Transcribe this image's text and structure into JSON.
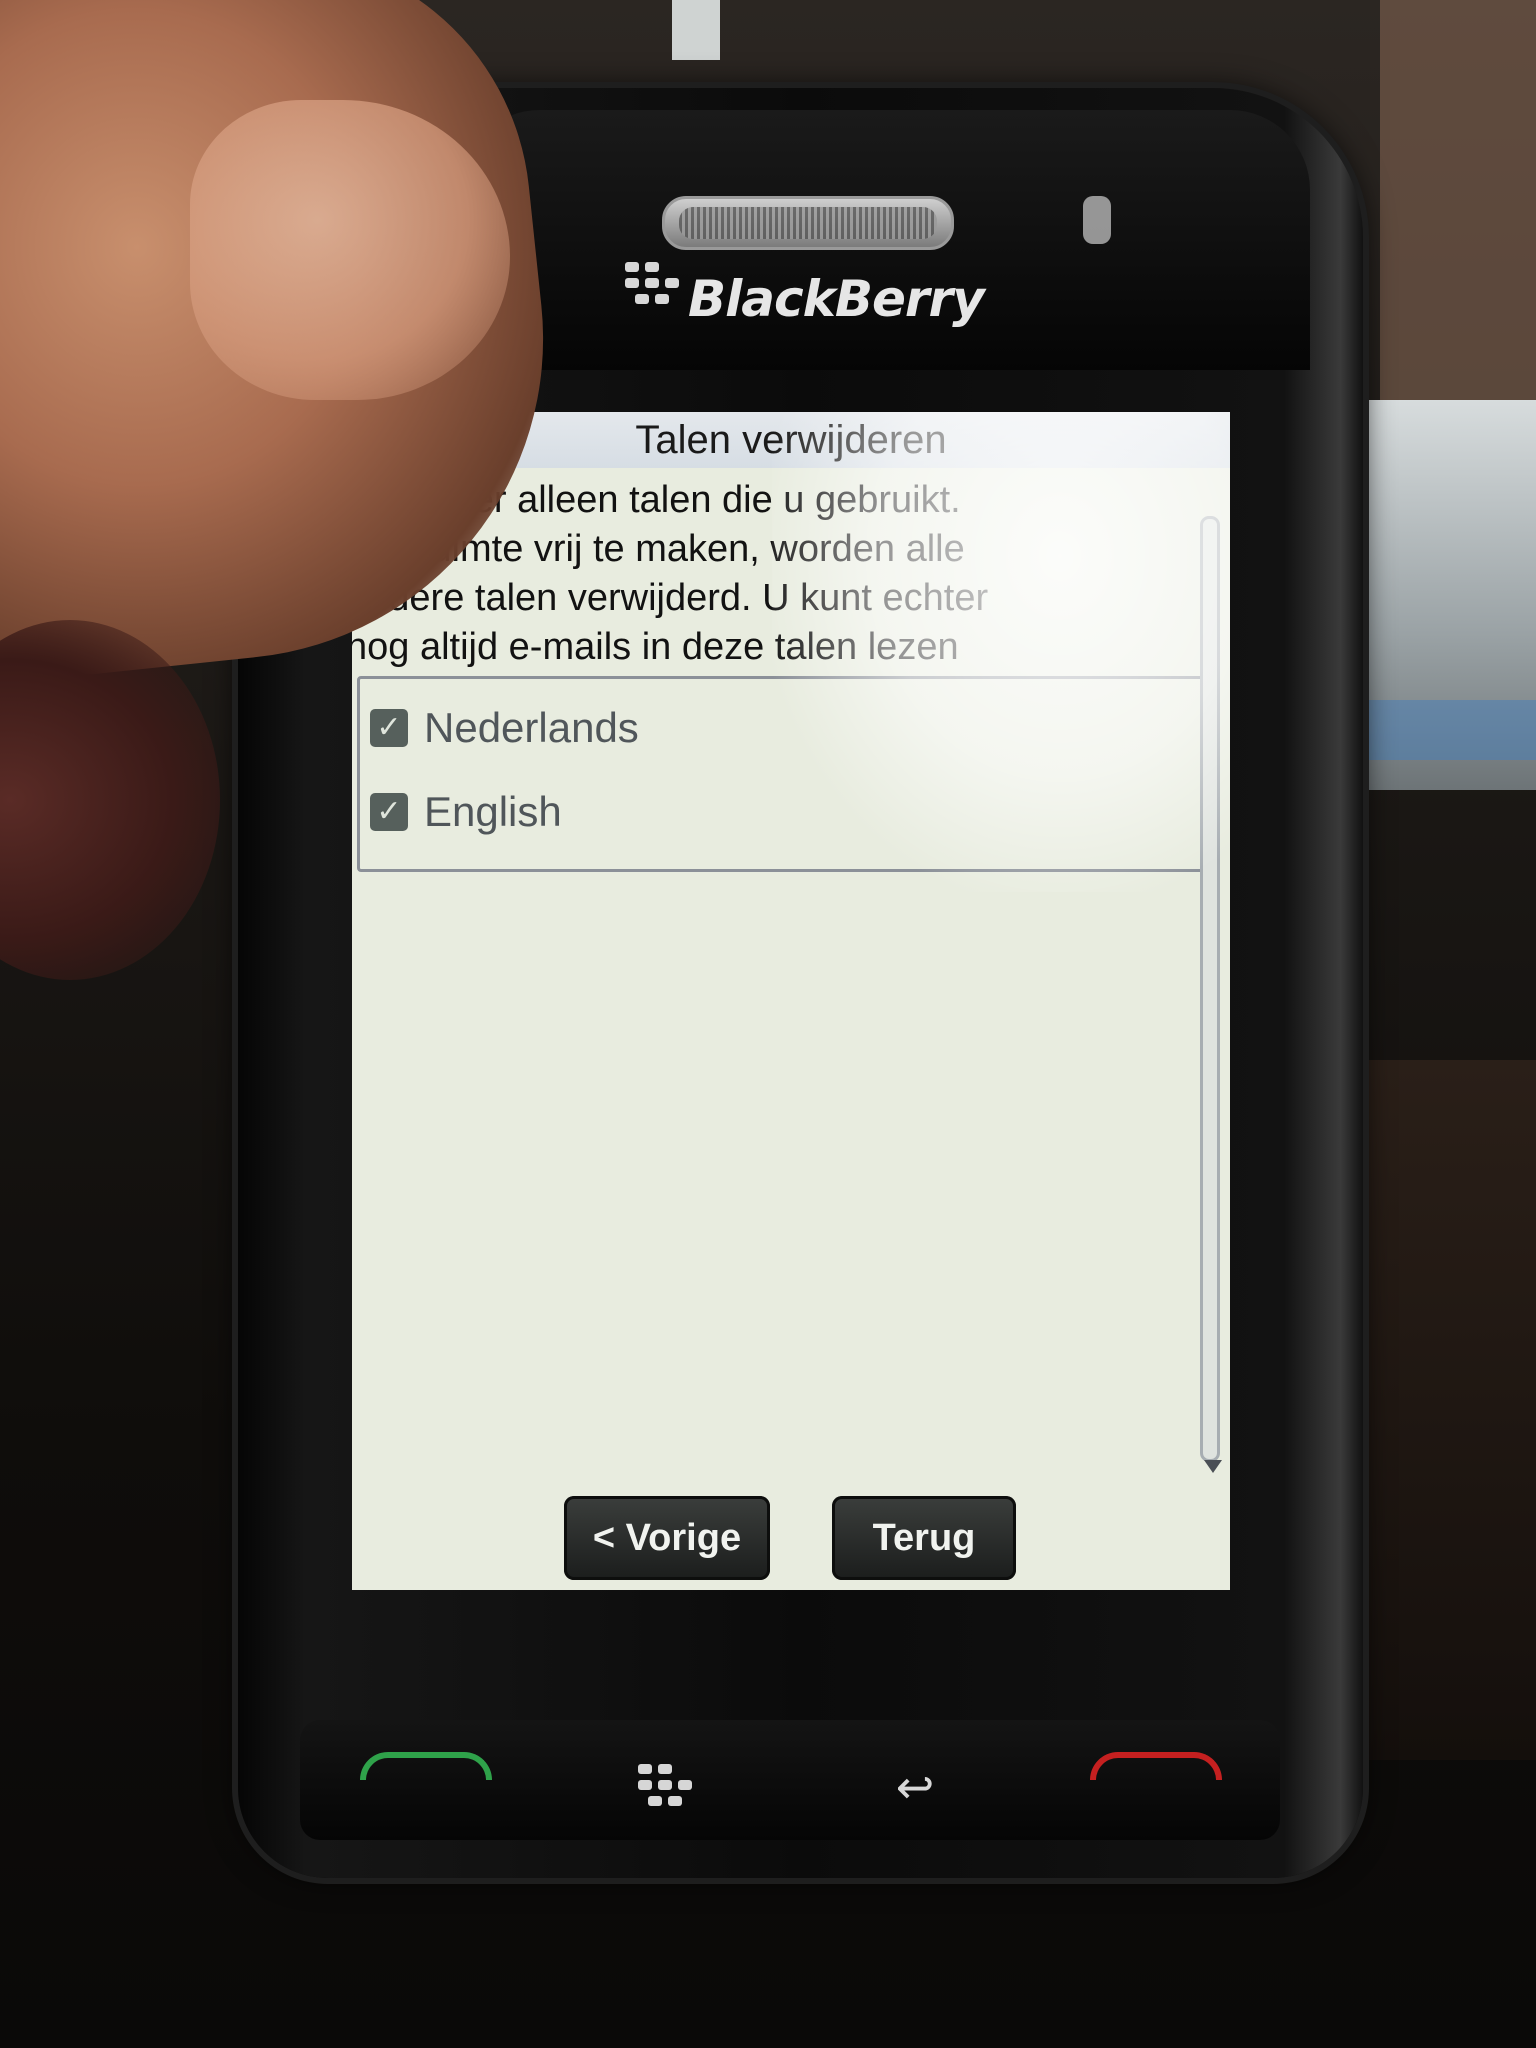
{
  "device": {
    "brand": "BlackBerry"
  },
  "screen": {
    "title": "Talen verwijderen",
    "instructions": "Selecteer alleen talen die u gebruikt.\nOm ruimte vrij te maken, worden alle\nandere talen verwijderd. U kunt echter\nnog altijd e-mails in deze talen lezen",
    "languages": [
      {
        "label": "Nederlands",
        "checked": true
      },
      {
        "label": "English",
        "checked": true
      }
    ],
    "buttons": {
      "previous": "< Vorige",
      "back": "Terug"
    }
  },
  "hardware_keys": {
    "call": "call-key",
    "menu": "blackberry-menu-key",
    "escape": "back-arrow-key",
    "end": "end-call-key"
  },
  "colors": {
    "screen_bg": "#e8ecdf",
    "button_bg": "#2a2c2b",
    "call_green": "#2fa24a",
    "end_red": "#c52020"
  }
}
